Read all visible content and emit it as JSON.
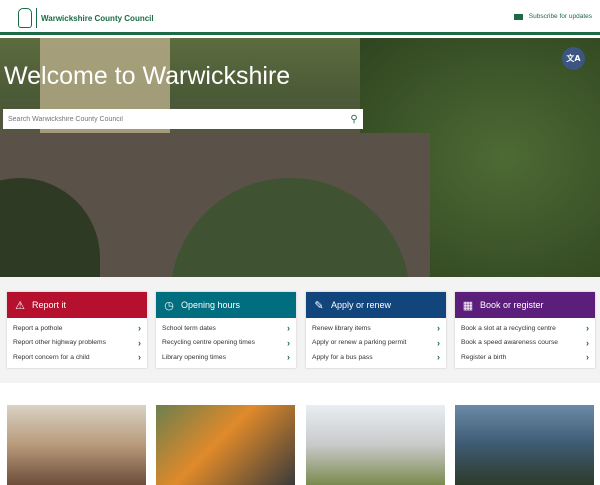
{
  "header": {
    "logo_text": "Warwickshire County Council",
    "subscribe_label": "Subscribe for updates"
  },
  "hero": {
    "title": "Welcome to Warwickshire",
    "search_placeholder": "Search Warwickshire County Council",
    "translate_icon": "translate-icon"
  },
  "cards": [
    {
      "title": "Report it",
      "color": "#b5112f",
      "icon": "warning-icon",
      "links": [
        "Report a pothole",
        "Report other highway problems",
        "Report concern for a child"
      ]
    },
    {
      "title": "Opening hours",
      "color": "#006e7f",
      "icon": "clock-icon",
      "links": [
        "School term dates",
        "Recycling centre opening times",
        "Library opening times"
      ]
    },
    {
      "title": "Apply or renew",
      "color": "#13457d",
      "icon": "form-icon",
      "links": [
        "Renew library items",
        "Apply or renew a parking permit",
        "Apply for a bus pass"
      ]
    },
    {
      "title": "Book or register",
      "color": "#5b1e7a",
      "icon": "calendar-icon",
      "links": [
        "Book a slot at a recycling centre",
        "Book a speed awareness course",
        "Register a birth"
      ]
    }
  ]
}
